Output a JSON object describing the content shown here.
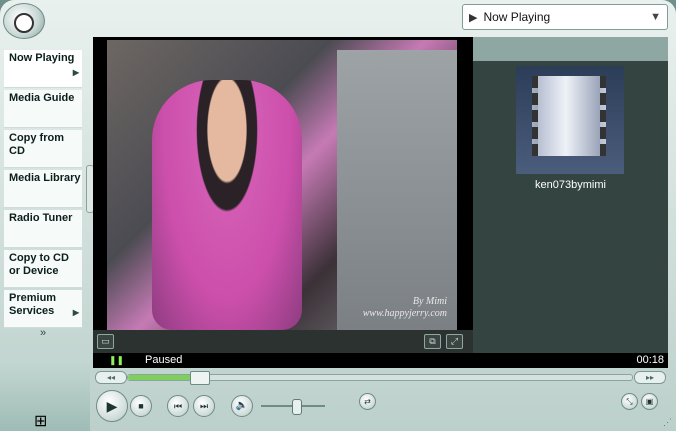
{
  "header": {
    "playlist_dropdown": {
      "label": "Now Playing",
      "icon": "now-playing-icon"
    }
  },
  "taskbar": {
    "items": [
      {
        "label": "Now Playing",
        "has_arrow": true,
        "active": true
      },
      {
        "label": "Media Guide",
        "has_arrow": false
      },
      {
        "label": "Copy from CD",
        "has_arrow": false
      },
      {
        "label": "Media Library",
        "has_arrow": false
      },
      {
        "label": "Radio Tuner",
        "has_arrow": false
      },
      {
        "label": "Copy to CD or Device",
        "has_arrow": false
      },
      {
        "label": "Premium Services",
        "has_arrow": true
      }
    ],
    "more_icon": "»"
  },
  "video": {
    "watermark_line1": "By Mimi",
    "watermark_line2": "www.happyjerry.com"
  },
  "playlist": {
    "item_title": "ken073bymimi"
  },
  "status": {
    "text": "Paused",
    "time": "00:18",
    "state_icon": "pause-icon"
  },
  "seek": {
    "progress": 0.14
  },
  "volume": {
    "level": 0.55
  }
}
